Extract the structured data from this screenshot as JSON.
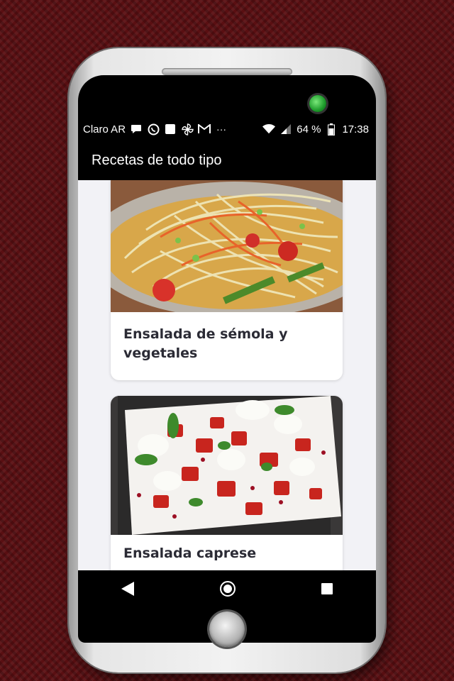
{
  "status_bar": {
    "carrier": "Claro AR",
    "icons": [
      "chat-icon",
      "whatsapp-icon",
      "square-icon",
      "pinwheel-icon",
      "gmail-icon",
      "more-dots-icon",
      "wifi-icon",
      "signal-icon",
      "battery-icon"
    ],
    "more": "···",
    "battery": "64 %",
    "time": "17:38"
  },
  "app_bar": {
    "title": "Recetas de todo tipo"
  },
  "recipes": [
    {
      "title": "Ensalada de sémola y vegetales",
      "image": "noodle-salad-photo"
    },
    {
      "title": "Ensalada caprese",
      "image": "caprese-salad-photo"
    }
  ],
  "nav_bar": {
    "icons": [
      "back-icon",
      "home-icon",
      "recents-icon"
    ]
  },
  "colors": {
    "background": "#5a0f12",
    "app_bar": "#000000",
    "card": "#ffffff",
    "title_text": "#2b2b35"
  }
}
